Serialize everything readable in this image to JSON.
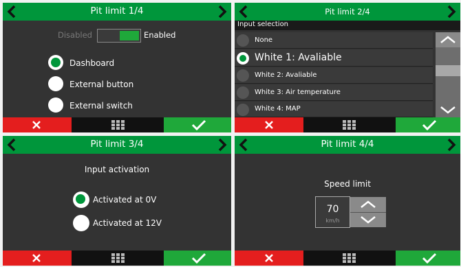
{
  "panel1": {
    "title": "Pit limit 1/4",
    "toggle_off_label": "Disabled",
    "toggle_on_label": "Enabled",
    "options": [
      "Dashboard",
      "External button",
      "External switch"
    ],
    "selected_index": 0
  },
  "panel2": {
    "title": "Pit limit 2/4",
    "subtitle": "Input selection",
    "options": [
      "None",
      "White 1: Avaliable",
      "White 2: Avaliable",
      "White 3: Air temperature",
      "White 4: MAP"
    ],
    "selected_index": 1
  },
  "panel3": {
    "title": "Pit limit 3/4",
    "heading": "Input activation",
    "options": [
      "Activated at 0V",
      "Activated at 12V"
    ],
    "selected_index": 0
  },
  "panel4": {
    "title": "Pit limit 4/4",
    "heading": "Speed limit",
    "value": "70",
    "unit": "km/h"
  },
  "colors": {
    "header": "#00963b",
    "cancel": "#e41e1e",
    "confirm": "#1fa83a",
    "background": "#333333"
  },
  "icons": {
    "back": "chevron-left-icon",
    "next": "chevron-right-icon",
    "cancel": "x-icon",
    "menu": "grid-menu-icon",
    "confirm": "checkmark-icon"
  }
}
